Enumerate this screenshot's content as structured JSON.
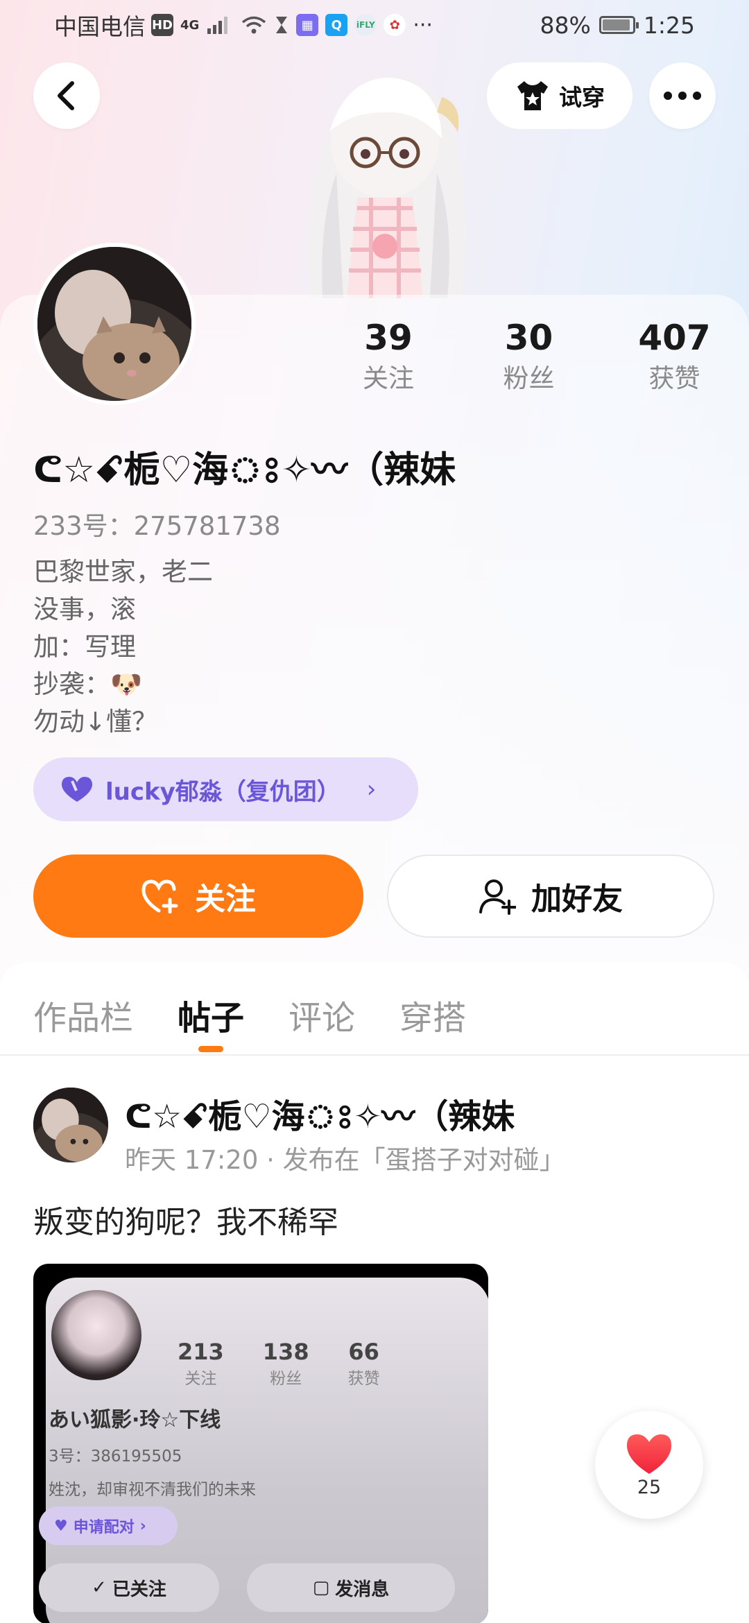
{
  "status_bar": {
    "carrier": "中国电信",
    "network": "4G",
    "battery": "88%",
    "time": "1:25"
  },
  "header": {
    "tryon_label": "试穿"
  },
  "profile": {
    "stats": [
      {
        "value": "39",
        "label": "关注"
      },
      {
        "value": "30",
        "label": "粉丝"
      },
      {
        "value": "407",
        "label": "获赞"
      }
    ],
    "nickname": "ᕦ☆ꗃ栀♡海ঃ✧〰（辣妹",
    "uid": "233号：275781738",
    "bio_lines": [
      "巴黎世家，老二",
      "没事，滚",
      "加：写理",
      "抄袭：🐶",
      "勿动↓懂？"
    ],
    "team_label": "lucky郁淼（复仇团）",
    "follow_label": "关注",
    "add_friend_label": "加好友"
  },
  "tabs": [
    {
      "label": "作品栏",
      "active": false
    },
    {
      "label": "帖子",
      "active": true
    },
    {
      "label": "评论",
      "active": false
    },
    {
      "label": "穿搭",
      "active": false
    }
  ],
  "post": {
    "author": "ᕦ☆ꗃ栀♡海ঃ✧〰（辣妹",
    "meta": "昨天 17:20 · 发布在「蛋搭子对对碰」",
    "text": "叛变的狗呢？我不稀罕",
    "image": {
      "stats": [
        {
          "value": "213",
          "label": "关注"
        },
        {
          "value": "138",
          "label": "粉丝"
        },
        {
          "value": "66",
          "label": "获赞"
        }
      ],
      "name": "あい狐影·玲☆下线",
      "id": "3号：386195505",
      "bio": "姓沈，却审视不清我们的未来",
      "chip": "申请配对",
      "btn1": "已关注",
      "btn2": "发消息"
    },
    "like_count": "25"
  },
  "colors": {
    "accent": "#ff7a12",
    "team_chip_bg": "#e6defa",
    "team_chip_text": "#6b55d8"
  }
}
